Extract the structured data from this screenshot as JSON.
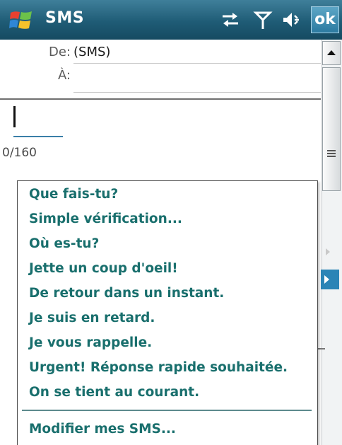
{
  "titlebar": {
    "app_title": "SMS",
    "ok_label": "ok",
    "icons": [
      "windows-start-icon",
      "connectivity-icon",
      "signal-icon",
      "volume-icon"
    ]
  },
  "header": {
    "from_label": "De:",
    "from_value": "(SMS)",
    "to_label": "À:",
    "to_value": ""
  },
  "message": {
    "body": "",
    "counter": "0/160"
  },
  "quick_text_menu": {
    "items": [
      "Que fais-tu?",
      "Simple vérification...",
      "Où es-tu?",
      "Jette un coup d'oeil!",
      "De retour dans un instant.",
      "Je suis en retard.",
      "Je vous rappelle.",
      "Urgent! Réponse rapide souhaitée.",
      "On se tient au courant."
    ],
    "edit_item": "Modifier mes SMS..."
  },
  "colors": {
    "titlebar": "#1f5c76",
    "menu_text": "#196f6d",
    "accent": "#2a84b6"
  }
}
